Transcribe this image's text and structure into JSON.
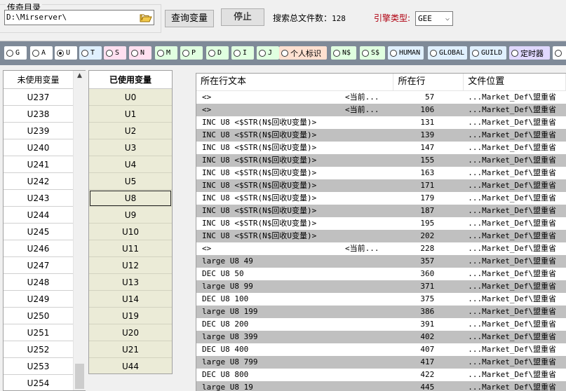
{
  "top": {
    "dir_group_title": "传奇目录",
    "dir_value": "D:\\Mirserver\\",
    "query_button": "查询变量",
    "stop_button": "停止",
    "count_label": "搜索总文件数：",
    "count_value": "128",
    "engine_label": "引擎类型:",
    "engine_value": "GEE"
  },
  "radios": [
    {
      "label": "G",
      "bg": "#ffffff",
      "checked": false
    },
    {
      "label": "A",
      "bg": "#ffffff",
      "checked": false
    },
    {
      "label": "U",
      "bg": "#ffffff",
      "checked": true
    },
    {
      "label": "T",
      "bg": "#e0f0ff",
      "checked": false
    },
    {
      "label": "S",
      "bg": "#ffe0f0",
      "checked": false
    },
    {
      "label": "N",
      "bg": "#ffe0f0",
      "checked": false
    },
    {
      "label": "M",
      "bg": "#e0ffe0",
      "checked": false
    },
    {
      "label": "P",
      "bg": "#e0ffe0",
      "checked": false
    },
    {
      "label": "D",
      "bg": "#e0ffe0",
      "checked": false
    },
    {
      "label": "I",
      "bg": "#e0ffe0",
      "checked": false
    },
    {
      "label": "J",
      "bg": "#e0ffe0",
      "checked": false
    },
    {
      "label": "个人标识",
      "bg": "#ffe0d0",
      "checked": false
    },
    {
      "label": "N$",
      "bg": "#e0ffe0",
      "checked": false
    },
    {
      "label": "S$",
      "bg": "#e0ffe0",
      "checked": false
    },
    {
      "label": "HUMAN",
      "bg": "#e0f0ff",
      "checked": false
    },
    {
      "label": "GLOBAL",
      "bg": "#e0f0ff",
      "checked": false
    },
    {
      "label": "GUILD",
      "bg": "#e0f0ff",
      "checked": false
    },
    {
      "label": "定时器",
      "bg": "#e0d8ff",
      "checked": false
    },
    {
      "label": "",
      "bg": "#ffffff",
      "checked": false
    }
  ],
  "unused": {
    "header": "未使用变量",
    "items": [
      "U237",
      "U238",
      "U239",
      "U240",
      "U241",
      "U242",
      "U243",
      "U244",
      "U245",
      "U246",
      "U247",
      "U248",
      "U249",
      "U250",
      "U251",
      "U252",
      "U253",
      "U254"
    ]
  },
  "used": {
    "header": "已使用变量",
    "selected": "U8",
    "items": [
      "U0",
      "U1",
      "U2",
      "U3",
      "U4",
      "U5",
      "U8",
      "U9",
      "U10",
      "U11",
      "U12",
      "U13",
      "U14",
      "U19",
      "U20",
      "U21",
      "U44"
    ]
  },
  "results": {
    "headers": {
      "text": "所在行文本",
      "line": "所在行",
      "loc": "文件位置"
    },
    "rows": [
      {
        "text": "<>",
        "rhs": "<当前...",
        "line": "57",
        "loc": "...Market_Def\\盟重省"
      },
      {
        "text": "<>",
        "rhs": "<当前...",
        "line": "106",
        "loc": "...Market_Def\\盟重省"
      },
      {
        "text": "INC U8 <$STR(N$回收U变量)>",
        "rhs": "",
        "line": "131",
        "loc": "...Market_Def\\盟重省"
      },
      {
        "text": "INC U8 <$STR(N$回收U变量)>",
        "rhs": "",
        "line": "139",
        "loc": "...Market_Def\\盟重省"
      },
      {
        "text": "INC U8 <$STR(N$回收U变量)>",
        "rhs": "",
        "line": "147",
        "loc": "...Market_Def\\盟重省"
      },
      {
        "text": "INC U8 <$STR(N$回收U变量)>",
        "rhs": "",
        "line": "155",
        "loc": "...Market_Def\\盟重省"
      },
      {
        "text": "INC U8 <$STR(N$回收U变量)>",
        "rhs": "",
        "line": "163",
        "loc": "...Market_Def\\盟重省"
      },
      {
        "text": "INC U8 <$STR(N$回收U变量)>",
        "rhs": "",
        "line": "171",
        "loc": "...Market_Def\\盟重省"
      },
      {
        "text": "INC U8 <$STR(N$回收U变量)>",
        "rhs": "",
        "line": "179",
        "loc": "...Market_Def\\盟重省"
      },
      {
        "text": "INC U8 <$STR(N$回收U变量)>",
        "rhs": "",
        "line": "187",
        "loc": "...Market_Def\\盟重省"
      },
      {
        "text": "INC U8 <$STR(N$回收U变量)>",
        "rhs": "",
        "line": "195",
        "loc": "...Market_Def\\盟重省"
      },
      {
        "text": "INC U8 <$STR(N$回收U变量)>",
        "rhs": "",
        "line": "202",
        "loc": "...Market_Def\\盟重省"
      },
      {
        "text": "<>",
        "rhs": "<当前...",
        "line": "228",
        "loc": "...Market_Def\\盟重省"
      },
      {
        "text": "large U8 49",
        "rhs": "",
        "line": "357",
        "loc": "...Market_Def\\盟重省"
      },
      {
        "text": "DEC U8 50",
        "rhs": "",
        "line": "360",
        "loc": "...Market_Def\\盟重省"
      },
      {
        "text": "large U8 99",
        "rhs": "",
        "line": "371",
        "loc": "...Market_Def\\盟重省"
      },
      {
        "text": "DEC U8 100",
        "rhs": "",
        "line": "375",
        "loc": "...Market_Def\\盟重省"
      },
      {
        "text": "large U8 199",
        "rhs": "",
        "line": "386",
        "loc": "...Market_Def\\盟重省"
      },
      {
        "text": "DEC U8 200",
        "rhs": "",
        "line": "391",
        "loc": "...Market_Def\\盟重省"
      },
      {
        "text": "large U8 399",
        "rhs": "",
        "line": "402",
        "loc": "...Market_Def\\盟重省"
      },
      {
        "text": "DEC U8 400",
        "rhs": "",
        "line": "407",
        "loc": "...Market_Def\\盟重省"
      },
      {
        "text": "large U8 799",
        "rhs": "",
        "line": "417",
        "loc": "...Market_Def\\盟重省"
      },
      {
        "text": "DEC U8 800",
        "rhs": "",
        "line": "422",
        "loc": "...Market_Def\\盟重省"
      },
      {
        "text": "large U8 19",
        "rhs": "",
        "line": "445",
        "loc": "...Market_Def\\盟重省"
      }
    ]
  }
}
